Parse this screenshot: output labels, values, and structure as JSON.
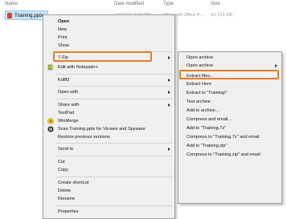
{
  "explorer": {
    "header": {
      "name": "Name",
      "date_modified": "Date modified",
      "type": "Type",
      "size": "Size"
    },
    "file": {
      "name": "Training.pptx",
      "date": "1/4/2019 3:56 PM",
      "type": "Microsoft Office P...",
      "size": "10,721 KB"
    }
  },
  "context_menu": {
    "items": [
      {
        "label": "Open"
      },
      {
        "label": "New"
      },
      {
        "label": "Print"
      },
      {
        "label": "Show"
      },
      {
        "label": "7-Zip",
        "submenu": true,
        "highlighted": true
      },
      {
        "label": "Edit with Notepad++",
        "icon": "notepadpp-icon"
      },
      {
        "label": "Kdiff3",
        "submenu": true
      },
      {
        "label": "Open with",
        "submenu": true
      },
      {
        "label": "Share with",
        "submenu": true
      },
      {
        "label": "TextPad"
      },
      {
        "label": "WinMerge",
        "icon": "winmerge-icon"
      },
      {
        "label": "Scan Training.pptx for Viruses and Spyware",
        "icon": "antivirus-icon"
      },
      {
        "label": "Restore previous versions"
      },
      {
        "label": "Send to",
        "submenu": true
      },
      {
        "label": "Cut"
      },
      {
        "label": "Copy"
      },
      {
        "label": "Create shortcut"
      },
      {
        "label": "Delete"
      },
      {
        "label": "Rename"
      },
      {
        "label": "Properties"
      }
    ]
  },
  "zip_submenu": {
    "items": [
      {
        "label": "Open archive"
      },
      {
        "label": "Open archive",
        "submenu": true
      },
      {
        "label": "Extract files...",
        "highlighted": true
      },
      {
        "label": "Extract Here"
      },
      {
        "label": "Extract to \"Training\\\""
      },
      {
        "label": "Test archive"
      },
      {
        "label": "Add to archive..."
      },
      {
        "label": "Compress and email..."
      },
      {
        "label": "Add to \"Training.7z\""
      },
      {
        "label": "Compress to \"Training.7z\" and email"
      },
      {
        "label": "Add to \"Training.zip\""
      },
      {
        "label": "Compress to \"Training.zip\" and email"
      }
    ]
  },
  "colors": {
    "highlight_border": "#e67e22",
    "selection": "#cce4f7"
  }
}
